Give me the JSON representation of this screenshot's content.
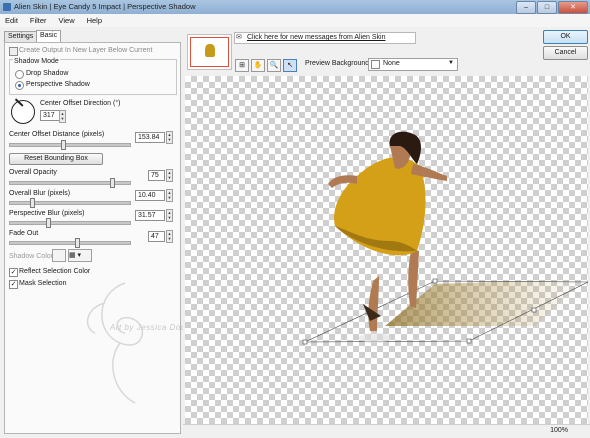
{
  "window": {
    "title": "Alien Skin | Eye Candy 5 Impact | Perspective Shadow",
    "minimize": "–",
    "maximize": "□",
    "close": "✕"
  },
  "menu": [
    "Edit",
    "Filter",
    "View",
    "Help"
  ],
  "tabs": {
    "settings": "Settings",
    "basic": "Basic"
  },
  "options": {
    "create_output_label": "Create Output In New Layer Below Current",
    "shadow_mode_label": "Shadow Mode",
    "drop_shadow_label": "Drop Shadow",
    "perspective_shadow_label": "Perspective Shadow",
    "center_offset_direction_label": "Center Offset Direction (°)",
    "center_offset_direction_value": "317",
    "center_offset_distance_label": "Center Offset Distance (pixels)",
    "center_offset_distance_value": "153.84",
    "reset_bounding_box": "Reset Bounding Box",
    "overall_opacity_label": "Overall Opacity",
    "overall_opacity_value": "75",
    "overall_blur_label": "Overall Blur (pixels)",
    "overall_blur_value": "10.40",
    "perspective_blur_label": "Perspective Blur (pixels)",
    "perspective_blur_value": "31.57",
    "fade_out_label": "Fade Out",
    "fade_out_value": "47",
    "shadow_color_label": "Shadow Color",
    "reflect_selection_label": "Reflect Selection Color",
    "mask_selection_label": "Mask Selection",
    "watermark": "Art by Jessica Dougherty"
  },
  "message_link": "Click here for new messages from Alien Skin",
  "preview_background_label": "Preview Background",
  "preview_background_value": "None",
  "ok": "OK",
  "cancel": "Cancel",
  "zoom": "100%",
  "colors": {
    "accent": "#2a5fb3",
    "dress": "#d4a017"
  }
}
